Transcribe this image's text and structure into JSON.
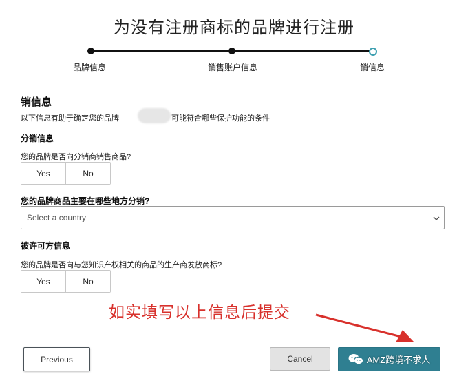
{
  "page": {
    "title": "为没有注册商标的品牌进行注册"
  },
  "stepper": {
    "steps": [
      "品牌信息",
      "销售账户信息",
      "销信息"
    ],
    "current_step": 3
  },
  "section": {
    "title": "销信息",
    "description_before": "以下信息有助于确定您的品牌",
    "description_after": "可能符合哪些保护功能的条件"
  },
  "distribution": {
    "heading": "分销信息",
    "question": "您的品牌是否向分销商销售商品?",
    "yes_label": "Yes",
    "no_label": "No",
    "where_label": "您的品牌商品主要在哪些地方分销?",
    "country_select_placeholder": "Select a country"
  },
  "licensee": {
    "heading": "被许可方信息",
    "question": "您的品牌是否向与您知识产权相关的商品的生产商发放商标?",
    "yes_label": "Yes",
    "no_label": "No"
  },
  "annotation": {
    "text": "如实填写以上信息后提交",
    "color": "#d8312c"
  },
  "footer": {
    "previous_label": "Previous",
    "cancel_label": "Cancel",
    "watermark_text": "AMZ跨境不求人"
  },
  "icons": {
    "select_chevron": "chevron-down-icon",
    "watermark": "wechat-icon",
    "arrow": "annotation-arrow-icon"
  },
  "colors": {
    "accent": "#2f7f91",
    "annotation": "#d8312c"
  }
}
